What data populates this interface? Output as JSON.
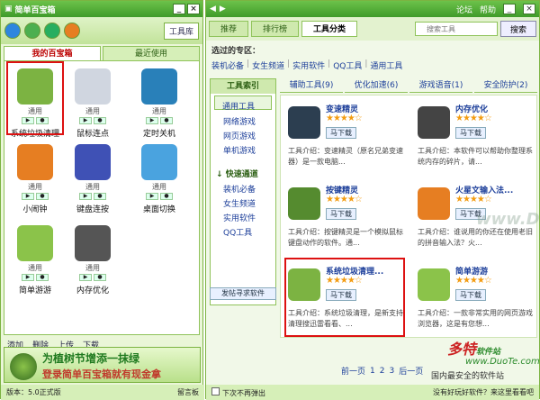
{
  "left": {
    "title": "简单百宝箱",
    "toolbox_label": "工具库",
    "tabs": [
      "我的百宝箱",
      "最近使用"
    ],
    "tiles": [
      {
        "name": "系统垃圾清理",
        "tag": "通用",
        "color": "#7cb342"
      },
      {
        "name": "鼠标连点",
        "tag": "通用",
        "color": "#d0d6e0"
      },
      {
        "name": "定时关机",
        "tag": "通用",
        "color": "#2980b9"
      },
      {
        "name": "小闹钟",
        "tag": "通用",
        "color": "#e67e22"
      },
      {
        "name": "键盘连按",
        "tag": "通用",
        "color": "#3f51b5"
      },
      {
        "name": "桌面切换",
        "tag": "通用",
        "color": "#4aa3df"
      },
      {
        "name": "简单游游",
        "tag": "通用",
        "color": "#8bc34a"
      },
      {
        "name": "内存优化",
        "tag": "通用",
        "color": "#555555"
      }
    ],
    "bottom_actions": [
      "添加",
      "删除",
      "上传",
      "下载"
    ],
    "banner_line1": "为植树节增添一抹绿",
    "banner_line2": "登录简单百宝箱就有现金拿",
    "version": "版本：5.0正式版",
    "guestbook": "留言板"
  },
  "right": {
    "top_links": [
      "论坛",
      "帮助"
    ],
    "tabs": [
      "推荐",
      "排行榜",
      "工具分类"
    ],
    "search_placeholder": "搜索工具",
    "search_button": "搜索",
    "zone_title": "选过的专区：",
    "zone_links": [
      "装机必备",
      "女生频道",
      "实用软件",
      "QQ工具",
      "通用工具"
    ],
    "index_title": "工具索引",
    "index_items": [
      "通用工具",
      "网络游戏",
      "网页游戏",
      "单机游戏"
    ],
    "quick_title": "快速通道",
    "quick_items": [
      "装机必备",
      "女生频道",
      "实用软件",
      "QQ工具"
    ],
    "post_button": "发帖寻求软件",
    "subtabs": [
      "辅助工具(9)",
      "优化加速(6)",
      "游戏语音(1)",
      "安全防护(2)"
    ],
    "cards": [
      {
        "title": "变速精灵",
        "desc": "工具介绍：变速精灵（原名兄弟变速器）是一款电脑...",
        "color": "#2c3e50",
        "stars": "★★★★☆"
      },
      {
        "title": "内存优化",
        "desc": "工具介绍：本软件可以帮助你整理系统内存的碎片，请...",
        "color": "#444444",
        "stars": "★★★★☆"
      },
      {
        "title": "按键精灵",
        "desc": "工具介绍：按键精灵是一个模拟鼠标键盘动作的软件。通...",
        "color": "#558b2f",
        "stars": "★★★★☆"
      },
      {
        "title": "火星文输入法...",
        "desc": "工具介绍：谁说用的你还在使用老旧的拼音输入法？火...",
        "color": "#e67e22",
        "stars": "★★★★☆"
      },
      {
        "title": "系统垃圾清理...",
        "desc": "工具介绍：系统垃圾清理，是新支持清理搜迅雷看看、...",
        "color": "#7cb342",
        "stars": "★★★★☆"
      },
      {
        "title": "简单游游",
        "desc": "工具介绍：一款非常实用的网页游戏浏览器，这是有您想...",
        "color": "#8bc34a",
        "stars": "★★★★☆"
      }
    ],
    "download_label": "马下载",
    "pager": {
      "prev": "前一页",
      "pages": [
        "1",
        "2",
        "3"
      ],
      "next": "后一页"
    },
    "dont_show": "下次不再弹出",
    "status_right": "没有好玩好软件？来这里看看吧",
    "watermark": "www.DuoTe.com",
    "logo_top": "多特",
    "logo_sub": "软件站",
    "logo_url": "www.DuoTe.com",
    "logo_tag": "国内最安全的软件站"
  }
}
